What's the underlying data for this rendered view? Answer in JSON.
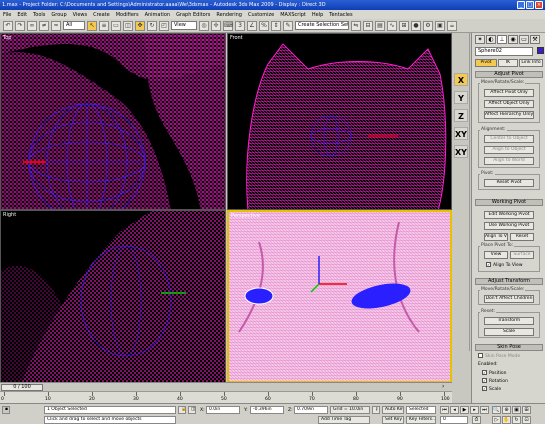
{
  "window": {
    "title": "1.max - Project Folder: C:\\Documents and Settings\\Administrator.aaaa\\We\\3dsmax - Autodesk 3ds Max 2009 - Display : Direct 3D"
  },
  "menu": [
    "File",
    "Edit",
    "Tools",
    "Group",
    "Views",
    "Create",
    "Modifiers",
    "Animation",
    "Graph Editors",
    "Rendering",
    "Customize",
    "MAXScript",
    "Help",
    "Tentacles"
  ],
  "toolbar": {
    "selection_filter": "All",
    "ref_coord": "View",
    "named_selection": "Create Selection Set"
  },
  "viewports": {
    "top": "Top",
    "front": "Front",
    "left": "Right",
    "persp": "Perspective"
  },
  "axis_constraints": [
    "X",
    "Y",
    "Z",
    "XY",
    "XY"
  ],
  "panel": {
    "object_name": "Sphere02",
    "tabs": [
      "Pivot",
      "IK",
      "Link Info"
    ],
    "sections": {
      "adjust_pivot": "Adjust Pivot",
      "move_rotate_scale": "Move/Rotate/Scale:",
      "affect_pivot_only": "Affect Pivot Only",
      "affect_object_only": "Affect Object Only",
      "affect_hierarchy_only": "Affect Hierarchy Only",
      "alignment": "Alignment:",
      "center_to_object": "Center to Object",
      "align_to_object": "Align to Object",
      "align_to_world": "Align to World",
      "pivot": "Pivot:",
      "reset_pivot": "Reset Pivot",
      "working_pivot": "Working Pivot",
      "edit_working_pivot": "Edit Working Pivot",
      "use_working_pivot": "Use Working Pivot",
      "align_to_view": "Align To View",
      "reset": "Reset",
      "place_pivot_to": "Place Pivot To:",
      "view": "View",
      "surface": "Surface",
      "align_to_view_chk": "Align To View",
      "adjust_transform": "Adjust Transform",
      "mrs2": "Move/Rotate/Scale:",
      "dont_affect_children": "Don't Affect Children",
      "reset2": "Reset:",
      "transform": "Transform",
      "scale": "Scale",
      "skin_pose": "Skin Pose",
      "skin_pose_mode": "Skin Pose Mode",
      "enabled": "Enabled:",
      "position": "Position",
      "rotation": "Rotation",
      "scale_chk": "Scale"
    }
  },
  "timeline": {
    "frame": "0 / 100",
    "ticks": [
      "0",
      "10",
      "20",
      "30",
      "40",
      "50",
      "60",
      "70",
      "80",
      "90",
      "100"
    ]
  },
  "status": {
    "selected": "1 Object Selected",
    "prompt": "Click and drag to select and move objects",
    "x": "0.0in",
    "y": "-0.396in",
    "z": "0.709in",
    "grid": "Grid = 10.0in",
    "autokey": "Auto Key",
    "selected_mode": "Selected",
    "setkey": "Set Key",
    "keyfilters": "Key Filters...",
    "add_time_tag": "Add Time Tag",
    "frame_field": "0"
  },
  "colors": {
    "wire": "#ff1fd0",
    "bg": "#000000",
    "active_border": "#e8c000",
    "sphere": "#2a20ff"
  }
}
